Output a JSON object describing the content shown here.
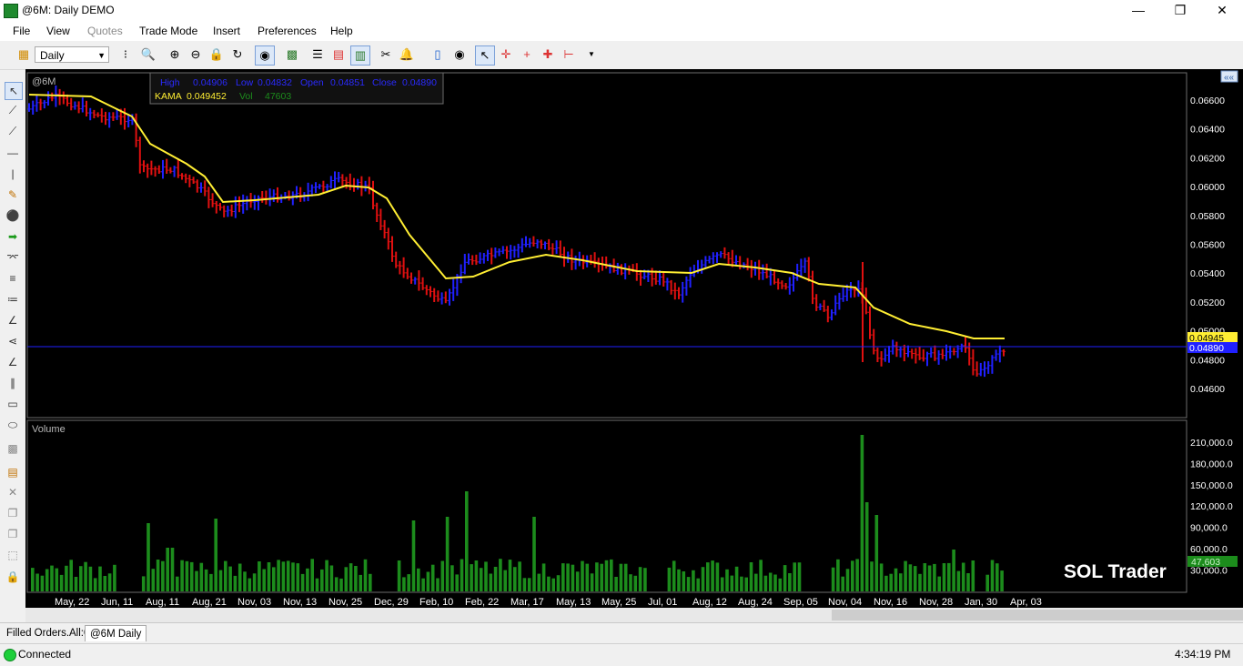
{
  "window": {
    "title": "@6M: Daily DEMO",
    "minimize": "—",
    "maximize": "❐",
    "close": "✕"
  },
  "menu": [
    "File",
    "View",
    "Quotes",
    "Trade Mode",
    "Insert",
    "Preferences",
    "Help"
  ],
  "toolbar": {
    "interval": "Daily"
  },
  "chart": {
    "symbol": "@6M",
    "tooltip": {
      "high_label": "High",
      "high": "0.04906",
      "low_label": "Low",
      "low": "0.04832",
      "open_label": "Open",
      "open": "0.04851",
      "close_label": "Close",
      "close": "0.04890",
      "kama_label": "KAMA",
      "kama": "0.049452",
      "vol_label": "Vol",
      "vol": "47603"
    },
    "price_labels": [
      "0.06600",
      "0.06400",
      "0.06200",
      "0.06000",
      "0.05800",
      "0.05600",
      "0.05400",
      "0.05200",
      "0.05000",
      "0.04800",
      "0.04600"
    ],
    "kama_tag": "0.04945",
    "close_tag": "0.04890",
    "volume_title": "Volume",
    "volume_labels": [
      "210,000.0",
      "180,000.0",
      "150,000.0",
      "120,000.0",
      "90,000.0",
      "60,000.0",
      "30,000.0"
    ],
    "volume_tag": "47,603",
    "watermark": "SOL Trader",
    "date_labels": [
      "May, 22",
      "Jun, 11",
      "Aug, 11",
      "Aug, 21",
      "Nov, 03",
      "Nov, 13",
      "Nov, 25",
      "Dec, 29",
      "Feb, 10",
      "Feb, 22",
      "Mar, 17",
      "May, 13",
      "May, 25",
      "Jul, 01",
      "Aug, 12",
      "Aug, 24",
      "Sep, 05",
      "Nov, 04",
      "Nov, 16",
      "Nov, 28",
      "Jan, 30",
      "Apr, 03"
    ]
  },
  "tabs": [
    "Filled Orders.All:0",
    "@6M Daily"
  ],
  "status": {
    "connection": "Connected",
    "time": "4:34:19 PM"
  },
  "colors": {
    "up": "#2020ff",
    "down": "#e01010",
    "kama": "#ffee33",
    "volume": "#1c8c1c",
    "background": "#000000"
  }
}
